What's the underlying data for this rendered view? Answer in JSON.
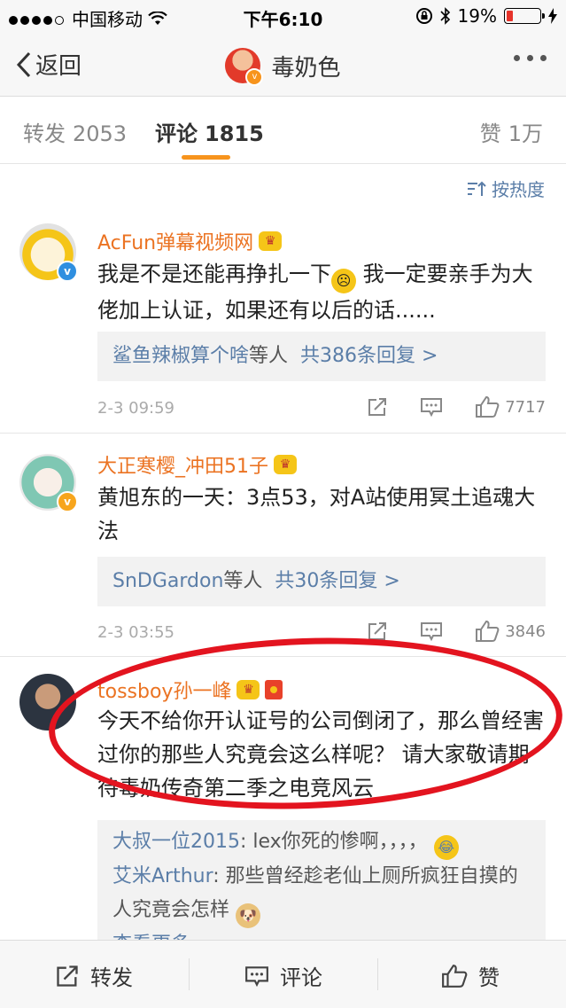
{
  "status_bar": {
    "carrier": "中国移动",
    "time": "下午6:10",
    "battery": "19%"
  },
  "nav": {
    "back_label": "返回",
    "title": "毒奶色"
  },
  "tabs": [
    {
      "label": "转发",
      "count": "2053"
    },
    {
      "label": "评论",
      "count": "1815"
    },
    {
      "label": "赞",
      "count": "1万"
    }
  ],
  "sort": {
    "label": "按热度"
  },
  "comments": [
    {
      "username": "AcFun弹幕视频网",
      "content_a": "我是不是还能再挣扎一下",
      "content_b": " 我一定要亲手为大佬加上认证，如果还有以后的话......",
      "reply_names": "鲨鱼辣椒算个啥",
      "reply_mid": "等人",
      "reply_count": "共386条回复 >",
      "time": "2-3 09:59",
      "likes": "7717"
    },
    {
      "username": "大正寒樱_冲田51子",
      "content": "黄旭东的一天：3点53，对A站使用冥土追魂大法",
      "reply_names": "SnDGardon",
      "reply_mid": "等人",
      "reply_count": "共30条回复 >",
      "time": "2-3 03:55",
      "likes": "3846"
    },
    {
      "username": "tossboy孙一峰",
      "content": "今天不给你开认证号的公司倒闭了，那么曾经害过你的那些人究竟会这么样呢？ 请大家敬请期待毒奶传奇第二季之电竞风云",
      "replies": [
        {
          "name": "大叔一位2015",
          "text": ": lex你死的惨啊，，，，"
        },
        {
          "name": "艾米Arthur",
          "text": ": 那些曾经趁老仙上厕所疯狂自摸的人究竟会怎样"
        }
      ],
      "more": "查看更多"
    }
  ],
  "bottom_bar": {
    "repost": "转发",
    "comment": "评论",
    "like": "赞"
  },
  "colors": {
    "accent": "#f7941d",
    "username": "#eb7322",
    "link": "#5b7ea8",
    "annotation": "#e3141f"
  }
}
